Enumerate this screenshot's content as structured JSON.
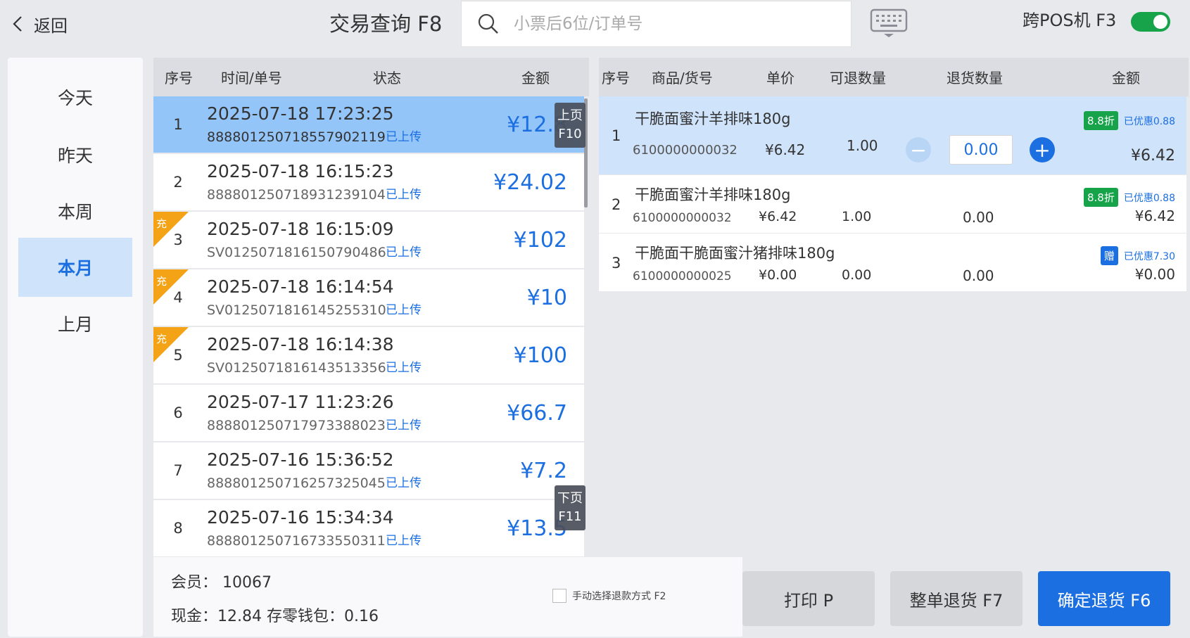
{
  "header": {
    "back_label": "返回",
    "title": "交易查询 F8",
    "search_placeholder": "小票后6位/订单号",
    "cross_pos_label": "跨POS机 F3",
    "cross_pos_enabled": true
  },
  "date_filters": [
    "今天",
    "昨天",
    "本周",
    "本月",
    "上月"
  ],
  "date_filter_selected": "本月",
  "transactions": {
    "columns": [
      "序号",
      "时间/单号",
      "状态",
      "金额"
    ],
    "rows": [
      {
        "no": "1",
        "time": "2025-07-18 17:23:25",
        "order": "8888012507185579021​19",
        "status": "已上传",
        "amount": "¥12.8",
        "tag": ""
      },
      {
        "no": "2",
        "time": "2025-07-18 16:15:23",
        "order": "888801250718931239104",
        "status": "已上传",
        "amount": "¥24.02",
        "tag": ""
      },
      {
        "no": "3",
        "time": "2025-07-18 16:15:09",
        "order": "SV0125071816150790486",
        "status": "已上传",
        "amount": "¥102",
        "tag": "充"
      },
      {
        "no": "4",
        "time": "2025-07-18 16:14:54",
        "order": "SV0125071816145255310",
        "status": "已上传",
        "amount": "¥10",
        "tag": "充"
      },
      {
        "no": "5",
        "time": "2025-07-18 16:14:38",
        "order": "SV0125071816143513356",
        "status": "已上传",
        "amount": "¥100",
        "tag": "充"
      },
      {
        "no": "6",
        "time": "2025-07-17 11:23:26",
        "order": "888801250717973388023",
        "status": "已上传",
        "amount": "¥66.7",
        "tag": ""
      },
      {
        "no": "7",
        "time": "2025-07-16 15:36:52",
        "order": "888801250716257325045",
        "status": "已上传",
        "amount": "¥7.2",
        "tag": ""
      },
      {
        "no": "8",
        "time": "2025-07-16 15:34:34",
        "order": "888801250716733550311",
        "status": "已上传",
        "amount": "¥13.5",
        "tag": ""
      }
    ],
    "prev_page": {
      "line1": "上页",
      "line2": "F10"
    },
    "next_page": {
      "line1": "下页",
      "line2": "F11"
    }
  },
  "summary": {
    "member": "会员： 10067",
    "cash": "现金：12.84 存零钱包：0.16",
    "manual_refund_label": "手动选择退款方式 F2"
  },
  "items": {
    "columns": [
      "序号",
      "商品/货号",
      "单价",
      "可退数量",
      "退货数量",
      "金额"
    ],
    "rows": [
      {
        "no": "1",
        "name": "干脆面蜜汁羊排味180g",
        "code": "6100000000032",
        "price": "¥6.42",
        "qty": "1.00",
        "return_qty": "0.00",
        "amount": "¥6.42",
        "badge": "8.8折",
        "badge_color": "#16a34a",
        "discount": "已优惠0.88"
      },
      {
        "no": "2",
        "name": "干脆面蜜汁羊排味180g",
        "code": "6100000000032",
        "price": "¥6.42",
        "qty": "1.00",
        "return_qty": "0.00",
        "amount": "¥6.42",
        "badge": "8.8折",
        "badge_color": "#16a34a",
        "discount": "已优惠0.88"
      },
      {
        "no": "3",
        "name": "干脆面干脆面蜜汁猪排味180g",
        "code": "6100000000025",
        "price": "¥0.00",
        "qty": "0.00",
        "return_qty": "0.00",
        "amount": "¥0.00",
        "badge": "赠",
        "badge_color": "#1c6fe0",
        "discount": "已优惠7.30"
      }
    ]
  },
  "buttons": {
    "print": "打印 P",
    "whole_return": "整单退货 F7",
    "confirm_return": "确定退货 F6"
  },
  "colors": {
    "accent": "#1c6fe0",
    "toggle_on": "#16a34a",
    "recharge_tag": "#f3a315"
  }
}
